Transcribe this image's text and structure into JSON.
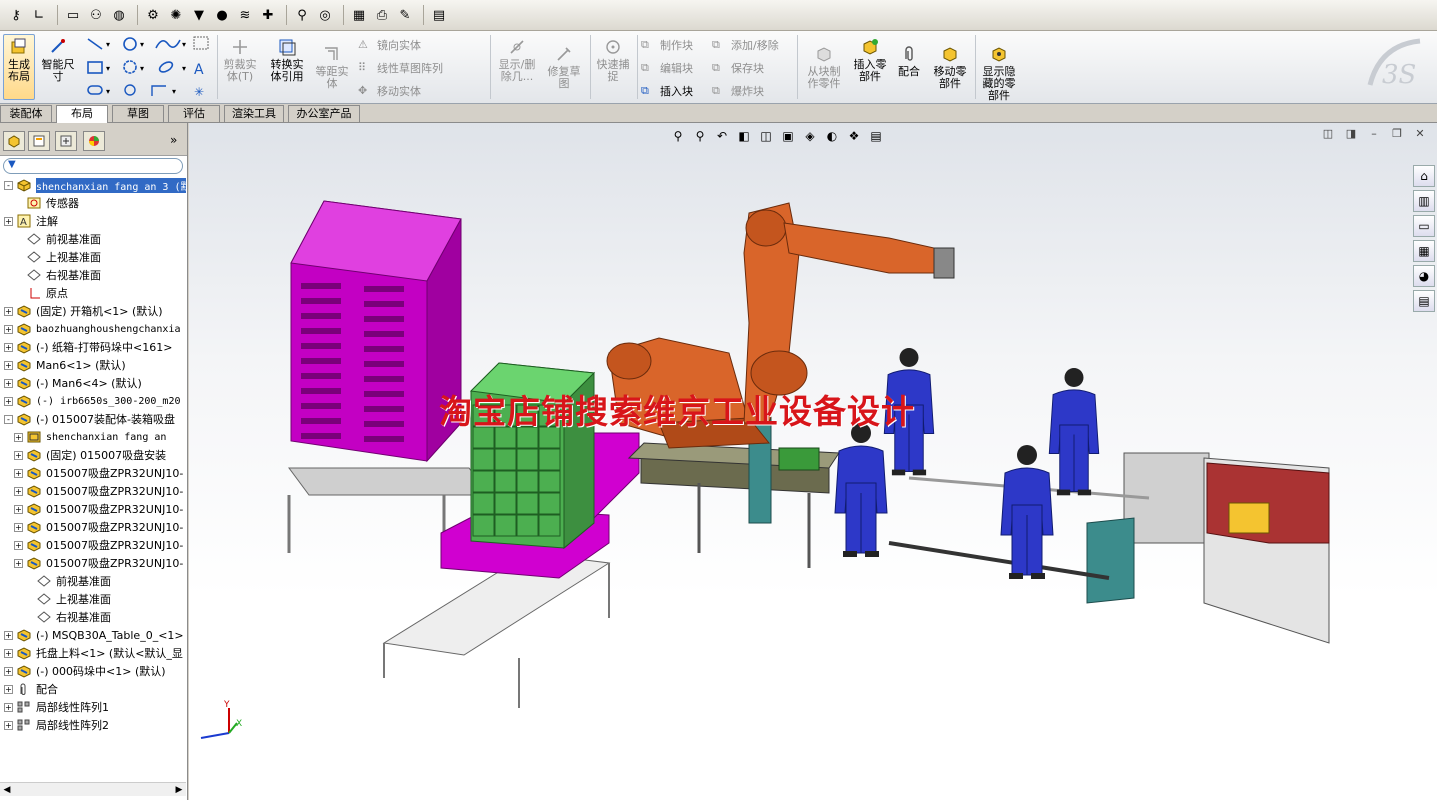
{
  "ribbon": {
    "gen_layout": "生成\n布局",
    "smart_dim": "智能尺\n寸",
    "trim_entity": "剪裁实\n体(T)",
    "convert_entity": "转换实\n体引用",
    "offset_entity": "等距实\n体",
    "mirror_entity": "镜向实体",
    "linear_pattern": "线性草图阵列",
    "move_entity": "移动实体",
    "show_delete": "显示/删\n除几...",
    "repair_sketch": "修复草\n图",
    "quick_snap": "快速捕\n捉",
    "make_block": "制作块",
    "edit_block": "编辑块",
    "insert_block": "插入块",
    "add_remove": "添加/移除",
    "save_block": "保存块",
    "explode_block": "爆炸块",
    "from_block": "从块制\n作零件",
    "insert_part": "插入零\n部件",
    "mate": "配合",
    "move_component": "移动零\n部件",
    "show_hidden": "显示隐\n藏的零\n部件"
  },
  "tabs": [
    "装配体",
    "布局",
    "草图",
    "评估",
    "渲染工具",
    "办公室产品"
  ],
  "active_tab": "布局",
  "tree": [
    {
      "label": "shenchanxian fang an 3  (默",
      "indent": 0,
      "exp": "-",
      "icon": "assembly-icon",
      "selected": true,
      "mono": true
    },
    {
      "label": "传感器",
      "indent": 1,
      "exp": "",
      "icon": "sensor-icon"
    },
    {
      "label": "注解",
      "indent": 0,
      "exp": "+",
      "icon": "annotation-icon"
    },
    {
      "label": "前视基准面",
      "indent": 1,
      "exp": "",
      "icon": "plane-icon"
    },
    {
      "label": "上视基准面",
      "indent": 1,
      "exp": "",
      "icon": "plane-icon"
    },
    {
      "label": "右视基准面",
      "indent": 1,
      "exp": "",
      "icon": "plane-icon"
    },
    {
      "label": "原点",
      "indent": 1,
      "exp": "",
      "icon": "origin-icon"
    },
    {
      "label": "(固定) 开箱机<1> (默认)",
      "indent": 0,
      "exp": "+",
      "icon": "subassembly-icon"
    },
    {
      "label": "baozhuanghoushengchanxia",
      "indent": 0,
      "exp": "+",
      "icon": "subassembly-icon",
      "mono": true
    },
    {
      "label": "(-) 纸箱-打带码垛中<161>",
      "indent": 0,
      "exp": "+",
      "icon": "subassembly-icon"
    },
    {
      "label": "Man6<1> (默认)",
      "indent": 0,
      "exp": "+",
      "icon": "subassembly-icon"
    },
    {
      "label": "(-) Man6<4> (默认)",
      "indent": 0,
      "exp": "+",
      "icon": "subassembly-icon"
    },
    {
      "label": "(-) irb6650s_300-200_m20",
      "indent": 0,
      "exp": "+",
      "icon": "subassembly-icon",
      "mono": true
    },
    {
      "label": "(-) 015007装配体-装箱吸盘",
      "indent": 0,
      "exp": "-",
      "icon": "subassembly-icon"
    },
    {
      "label": "shenchanxian fang an",
      "indent": 1,
      "exp": "+",
      "icon": "layout-icon",
      "mono": true
    },
    {
      "label": "(固定) 015007吸盘安装",
      "indent": 1,
      "exp": "+",
      "icon": "subassembly-icon"
    },
    {
      "label": "015007吸盘ZPR32UNJ10-",
      "indent": 1,
      "exp": "+",
      "icon": "subassembly-icon"
    },
    {
      "label": "015007吸盘ZPR32UNJ10-",
      "indent": 1,
      "exp": "+",
      "icon": "subassembly-icon"
    },
    {
      "label": "015007吸盘ZPR32UNJ10-",
      "indent": 1,
      "exp": "+",
      "icon": "subassembly-icon"
    },
    {
      "label": "015007吸盘ZPR32UNJ10-",
      "indent": 1,
      "exp": "+",
      "icon": "subassembly-icon"
    },
    {
      "label": "015007吸盘ZPR32UNJ10-",
      "indent": 1,
      "exp": "+",
      "icon": "subassembly-icon"
    },
    {
      "label": "015007吸盘ZPR32UNJ10-",
      "indent": 1,
      "exp": "+",
      "icon": "subassembly-icon"
    },
    {
      "label": "前视基准面",
      "indent": 2,
      "exp": "",
      "icon": "plane-icon"
    },
    {
      "label": "上视基准面",
      "indent": 2,
      "exp": "",
      "icon": "plane-icon"
    },
    {
      "label": "右视基准面",
      "indent": 2,
      "exp": "",
      "icon": "plane-icon"
    },
    {
      "label": "(-) MSQB30A_Table_0_<1>",
      "indent": 0,
      "exp": "+",
      "icon": "subassembly-icon"
    },
    {
      "label": "托盘上料<1> (默认<默认_显",
      "indent": 0,
      "exp": "+",
      "icon": "subassembly-icon"
    },
    {
      "label": "(-) 000码垛中<1> (默认)",
      "indent": 0,
      "exp": "+",
      "icon": "subassembly-icon"
    },
    {
      "label": "配合",
      "indent": 0,
      "exp": "+",
      "icon": "mate-icon"
    },
    {
      "label": "局部线性阵列1",
      "indent": 0,
      "exp": "+",
      "icon": "pattern-icon"
    },
    {
      "label": "局部线性阵列2",
      "indent": 0,
      "exp": "+",
      "icon": "pattern-icon"
    }
  ],
  "watermark": "淘宝店铺搜索维京工业设备设计",
  "colors": {
    "selection": "#316ac5",
    "watermark": "#d8151a",
    "pallet": "#d000d0",
    "boxes": "#4caf50",
    "robot": "#d9652a",
    "operator": "#2d38c8"
  }
}
